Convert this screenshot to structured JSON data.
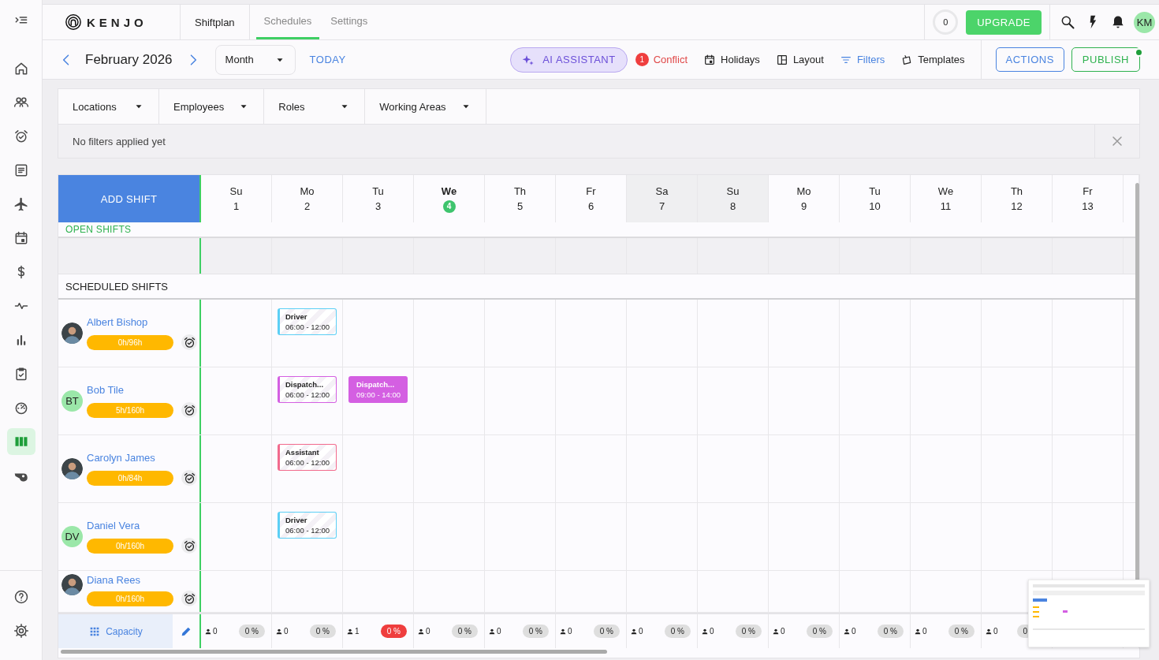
{
  "sidebar": {
    "items": [
      {
        "selected": false
      },
      {
        "selected": false
      },
      {
        "selected": false
      },
      {
        "selected": false
      },
      {
        "selected": false
      },
      {
        "selected": false
      },
      {
        "selected": false
      },
      {
        "selected": false
      },
      {
        "selected": false
      },
      {
        "selected": false
      },
      {
        "selected": false
      },
      {
        "selected": true
      },
      {
        "selected": false
      }
    ]
  },
  "header": {
    "brand": "KENJO",
    "section": "Shiftplan",
    "tabs": [
      {
        "label": "Schedules",
        "selected": true
      },
      {
        "label": "Settings",
        "selected": false
      }
    ],
    "counter": "0",
    "upgrade": "UPGRADE",
    "user_initials": "KM"
  },
  "toolbar": {
    "period": "February 2026",
    "view": "Month",
    "today": "TODAY",
    "ai_assistant": "AI ASSISTANT",
    "conflict_count": "1",
    "conflict": "Conflict",
    "holidays": "Holidays",
    "layout": "Layout",
    "filters": "Filters",
    "templates": "Templates",
    "actions": "ACTIONS",
    "publish": "PUBLISH",
    "publish_pending": true
  },
  "filters": {
    "dropdowns": [
      "Locations",
      "Employees",
      "Roles",
      "Working Areas"
    ],
    "empty_message": "No filters applied yet"
  },
  "schedule": {
    "add_shift": "ADD SHIFT",
    "days": [
      {
        "weekday": "Su",
        "date": "1",
        "shaded": false,
        "today": false
      },
      {
        "weekday": "Mo",
        "date": "2",
        "shaded": false,
        "today": false
      },
      {
        "weekday": "Tu",
        "date": "3",
        "shaded": false,
        "today": false
      },
      {
        "weekday": "We",
        "date": "4",
        "shaded": false,
        "today": true
      },
      {
        "weekday": "Th",
        "date": "5",
        "shaded": false,
        "today": false
      },
      {
        "weekday": "Fr",
        "date": "6",
        "shaded": false,
        "today": false
      },
      {
        "weekday": "Sa",
        "date": "7",
        "shaded": true,
        "today": false
      },
      {
        "weekday": "Su",
        "date": "8",
        "shaded": true,
        "today": false
      },
      {
        "weekday": "Mo",
        "date": "9",
        "shaded": false,
        "today": false
      },
      {
        "weekday": "Tu",
        "date": "10",
        "shaded": false,
        "today": false
      },
      {
        "weekday": "We",
        "date": "11",
        "shaded": false,
        "today": false
      },
      {
        "weekday": "Th",
        "date": "12",
        "shaded": false,
        "today": false
      },
      {
        "weekday": "Fr",
        "date": "13",
        "shaded": false,
        "today": false
      }
    ],
    "open_shifts": "OPEN SHIFTS",
    "scheduled_shifts": "SCHEDULED SHIFTS",
    "employees": [
      {
        "name": "Albert Bishop",
        "avatar": {
          "kind": "photo"
        },
        "hours": "0h/96h",
        "cells": [
          {
            "kind": "empty"
          },
          {
            "kind": "outline",
            "role": "Driver",
            "time": "06:00 - 12:00",
            "color": "#5ccff5"
          },
          {
            "kind": "empty"
          },
          {
            "kind": "empty"
          },
          {
            "kind": "empty"
          },
          {
            "kind": "empty"
          },
          {
            "kind": "empty"
          },
          {
            "kind": "empty"
          },
          {
            "kind": "empty"
          },
          {
            "kind": "empty"
          },
          {
            "kind": "empty"
          },
          {
            "kind": "empty"
          },
          {
            "kind": "empty"
          }
        ]
      },
      {
        "name": "Bob Tile",
        "avatar": {
          "kind": "initials",
          "initials": "BT"
        },
        "hours": "5h/160h",
        "cells": [
          {
            "kind": "empty"
          },
          {
            "kind": "outline",
            "role": "Dispatch...",
            "time": "06:00 - 12:00",
            "color": "#d45fe2"
          },
          {
            "kind": "filled",
            "role": "Dispatch...",
            "time": "09:00 - 14:00",
            "color": "#d45fe2"
          },
          {
            "kind": "empty"
          },
          {
            "kind": "empty"
          },
          {
            "kind": "empty"
          },
          {
            "kind": "empty"
          },
          {
            "kind": "empty"
          },
          {
            "kind": "empty"
          },
          {
            "kind": "empty"
          },
          {
            "kind": "empty"
          },
          {
            "kind": "empty"
          },
          {
            "kind": "empty"
          }
        ]
      },
      {
        "name": "Carolyn James",
        "avatar": {
          "kind": "photo"
        },
        "hours": "0h/84h",
        "cells": [
          {
            "kind": "empty"
          },
          {
            "kind": "outline",
            "role": "Assistant",
            "time": "06:00 - 12:00",
            "color": "#f26a8d"
          },
          {
            "kind": "empty"
          },
          {
            "kind": "empty"
          },
          {
            "kind": "empty"
          },
          {
            "kind": "empty"
          },
          {
            "kind": "empty"
          },
          {
            "kind": "empty"
          },
          {
            "kind": "empty"
          },
          {
            "kind": "empty"
          },
          {
            "kind": "empty"
          },
          {
            "kind": "empty"
          },
          {
            "kind": "empty"
          }
        ]
      },
      {
        "name": "Daniel Vera",
        "avatar": {
          "kind": "initials",
          "initials": "DV"
        },
        "hours": "0h/160h",
        "cells": [
          {
            "kind": "empty"
          },
          {
            "kind": "outline",
            "role": "Driver",
            "time": "06:00 - 12:00",
            "color": "#5ccff5"
          },
          {
            "kind": "empty"
          },
          {
            "kind": "empty"
          },
          {
            "kind": "empty"
          },
          {
            "kind": "empty"
          },
          {
            "kind": "empty"
          },
          {
            "kind": "empty"
          },
          {
            "kind": "empty"
          },
          {
            "kind": "empty"
          },
          {
            "kind": "empty"
          },
          {
            "kind": "empty"
          },
          {
            "kind": "empty"
          }
        ]
      },
      {
        "name": "Diana Rees",
        "avatar": {
          "kind": "photo"
        },
        "hours": "0h/160h",
        "cells": [
          {
            "kind": "empty"
          },
          {
            "kind": "empty"
          },
          {
            "kind": "empty"
          },
          {
            "kind": "empty"
          },
          {
            "kind": "empty"
          },
          {
            "kind": "empty"
          },
          {
            "kind": "empty"
          },
          {
            "kind": "empty"
          },
          {
            "kind": "empty"
          },
          {
            "kind": "empty"
          },
          {
            "kind": "empty"
          },
          {
            "kind": "empty"
          },
          {
            "kind": "empty"
          }
        ]
      }
    ],
    "capacity": {
      "label": "Capacity",
      "days": [
        {
          "people": "0",
          "percent": "0 %",
          "alert": false
        },
        {
          "people": "0",
          "percent": "0 %",
          "alert": false
        },
        {
          "people": "1",
          "percent": "0 %",
          "alert": true
        },
        {
          "people": "0",
          "percent": "0 %",
          "alert": false
        },
        {
          "people": "0",
          "percent": "0 %",
          "alert": false
        },
        {
          "people": "0",
          "percent": "0 %",
          "alert": false
        },
        {
          "people": "0",
          "percent": "0 %",
          "alert": false
        },
        {
          "people": "0",
          "percent": "0 %",
          "alert": false
        },
        {
          "people": "0",
          "percent": "0 %",
          "alert": false
        },
        {
          "people": "0",
          "percent": "0 %",
          "alert": false
        },
        {
          "people": "0",
          "percent": "0 %",
          "alert": false
        },
        {
          "people": "0",
          "percent": "0",
          "alert": false
        }
      ]
    }
  }
}
